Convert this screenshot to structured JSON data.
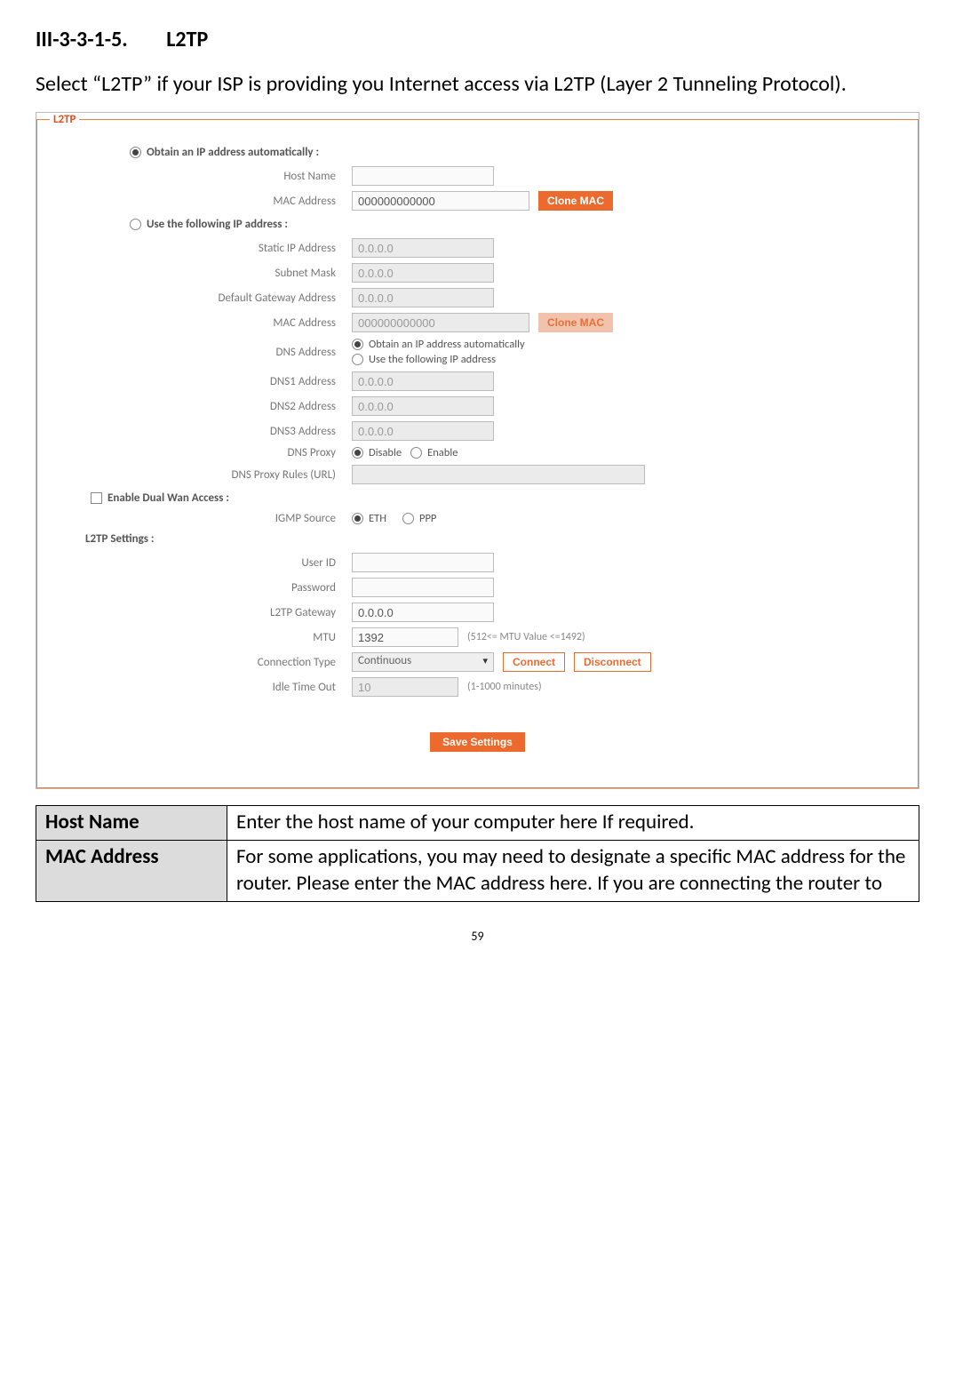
{
  "heading": {
    "num": "III-3-3-1-5.",
    "title": "L2TP"
  },
  "intro": "Select “L2TP” if your ISP is providing you Internet access via L2TP (Layer 2 Tunneling Protocol).",
  "fieldset_legend": "L2TP",
  "auto": {
    "radio_label": "Obtain an IP address automatically  :",
    "host_name_label": "Host Name",
    "host_name_value": "",
    "mac_label": "MAC Address",
    "mac_value": "000000000000",
    "clone_btn": "Clone MAC"
  },
  "manual": {
    "radio_label": "Use the following IP address  :",
    "static_ip_label": "Static IP  Address",
    "static_ip_value": "0.0.0.0",
    "subnet_label": "Subnet Mask",
    "subnet_value": "0.0.0.0",
    "gateway_label": "Default Gateway Address",
    "gateway_value": "0.0.0.0",
    "mac_label": "MAC Address",
    "mac_value": "000000000000",
    "clone_btn": "Clone MAC",
    "dns_addr_label": "DNS  Address",
    "dns_auto": "Obtain an IP address automatically",
    "dns_manual": "Use the following IP address",
    "dns1_label": "DNS1  Address",
    "dns1_value": "0.0.0.0",
    "dns2_label": "DNS2  Address",
    "dns2_value": "0.0.0.0",
    "dns3_label": "DNS3  Address",
    "dns3_value": "0.0.0.0",
    "dns_proxy_label": "DNS Proxy",
    "disable": "Disable",
    "enable": "Enable",
    "dns_proxy_rules_label": "DNS Proxy Rules (URL)",
    "dns_proxy_rules_value": ""
  },
  "dualwan": {
    "label": "Enable  Dual Wan Access  :",
    "igmp_label": "IGMP Source",
    "eth": "ETH",
    "ppp": "PPP"
  },
  "l2tp": {
    "heading": "L2TP  Settings  :",
    "user_label": "User ID",
    "user_value": "",
    "pass_label": "Password",
    "pass_value": "",
    "gw_label": "L2TP Gateway",
    "gw_value": "0.0.0.0",
    "mtu_label": "MTU",
    "mtu_value": "1392",
    "mtu_hint": "(512<= MTU  Value <=1492)",
    "conn_label": "Connection Type",
    "conn_value": "Continuous",
    "connect_btn": "Connect",
    "disconnect_btn": "Disconnect",
    "idle_label": "Idle Time Out",
    "idle_value": "10",
    "idle_hint": "(1-1000 minutes)"
  },
  "save_btn": "Save Settings",
  "table": {
    "r1h": "Host Name",
    "r1v": "Enter the host name of your computer here If required.",
    "r2h": "MAC Address",
    "r2v": "For some applications, you may need to designate a specific MAC address for the router. Please enter the MAC address here. If you are connecting the router to"
  },
  "page_number": "59"
}
